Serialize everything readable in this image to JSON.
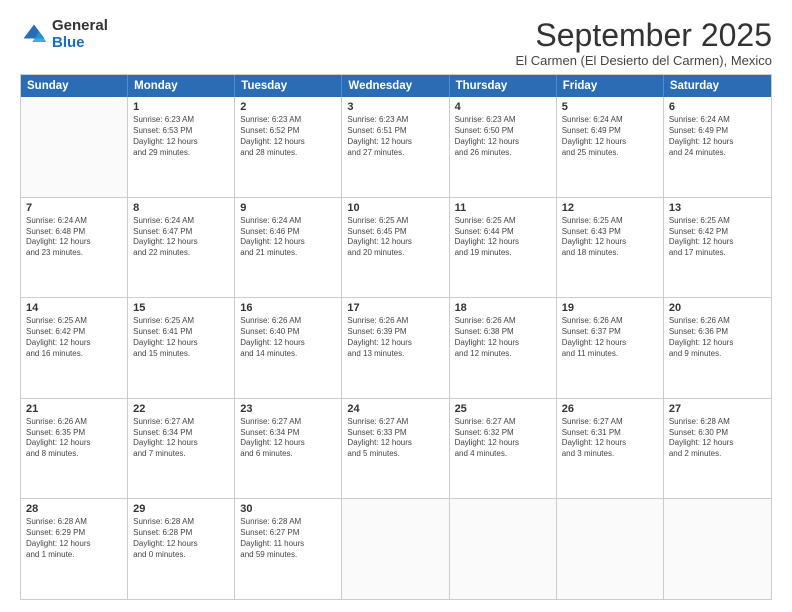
{
  "logo": {
    "general": "General",
    "blue": "Blue"
  },
  "title": "September 2025",
  "subtitle": "El Carmen (El Desierto del Carmen), Mexico",
  "header_days": [
    "Sunday",
    "Monday",
    "Tuesday",
    "Wednesday",
    "Thursday",
    "Friday",
    "Saturday"
  ],
  "rows": [
    [
      {
        "day": "",
        "lines": []
      },
      {
        "day": "1",
        "lines": [
          "Sunrise: 6:23 AM",
          "Sunset: 6:53 PM",
          "Daylight: 12 hours",
          "and 29 minutes."
        ]
      },
      {
        "day": "2",
        "lines": [
          "Sunrise: 6:23 AM",
          "Sunset: 6:52 PM",
          "Daylight: 12 hours",
          "and 28 minutes."
        ]
      },
      {
        "day": "3",
        "lines": [
          "Sunrise: 6:23 AM",
          "Sunset: 6:51 PM",
          "Daylight: 12 hours",
          "and 27 minutes."
        ]
      },
      {
        "day": "4",
        "lines": [
          "Sunrise: 6:23 AM",
          "Sunset: 6:50 PM",
          "Daylight: 12 hours",
          "and 26 minutes."
        ]
      },
      {
        "day": "5",
        "lines": [
          "Sunrise: 6:24 AM",
          "Sunset: 6:49 PM",
          "Daylight: 12 hours",
          "and 25 minutes."
        ]
      },
      {
        "day": "6",
        "lines": [
          "Sunrise: 6:24 AM",
          "Sunset: 6:49 PM",
          "Daylight: 12 hours",
          "and 24 minutes."
        ]
      }
    ],
    [
      {
        "day": "7",
        "lines": [
          "Sunrise: 6:24 AM",
          "Sunset: 6:48 PM",
          "Daylight: 12 hours",
          "and 23 minutes."
        ]
      },
      {
        "day": "8",
        "lines": [
          "Sunrise: 6:24 AM",
          "Sunset: 6:47 PM",
          "Daylight: 12 hours",
          "and 22 minutes."
        ]
      },
      {
        "day": "9",
        "lines": [
          "Sunrise: 6:24 AM",
          "Sunset: 6:46 PM",
          "Daylight: 12 hours",
          "and 21 minutes."
        ]
      },
      {
        "day": "10",
        "lines": [
          "Sunrise: 6:25 AM",
          "Sunset: 6:45 PM",
          "Daylight: 12 hours",
          "and 20 minutes."
        ]
      },
      {
        "day": "11",
        "lines": [
          "Sunrise: 6:25 AM",
          "Sunset: 6:44 PM",
          "Daylight: 12 hours",
          "and 19 minutes."
        ]
      },
      {
        "day": "12",
        "lines": [
          "Sunrise: 6:25 AM",
          "Sunset: 6:43 PM",
          "Daylight: 12 hours",
          "and 18 minutes."
        ]
      },
      {
        "day": "13",
        "lines": [
          "Sunrise: 6:25 AM",
          "Sunset: 6:42 PM",
          "Daylight: 12 hours",
          "and 17 minutes."
        ]
      }
    ],
    [
      {
        "day": "14",
        "lines": [
          "Sunrise: 6:25 AM",
          "Sunset: 6:42 PM",
          "Daylight: 12 hours",
          "and 16 minutes."
        ]
      },
      {
        "day": "15",
        "lines": [
          "Sunrise: 6:25 AM",
          "Sunset: 6:41 PM",
          "Daylight: 12 hours",
          "and 15 minutes."
        ]
      },
      {
        "day": "16",
        "lines": [
          "Sunrise: 6:26 AM",
          "Sunset: 6:40 PM",
          "Daylight: 12 hours",
          "and 14 minutes."
        ]
      },
      {
        "day": "17",
        "lines": [
          "Sunrise: 6:26 AM",
          "Sunset: 6:39 PM",
          "Daylight: 12 hours",
          "and 13 minutes."
        ]
      },
      {
        "day": "18",
        "lines": [
          "Sunrise: 6:26 AM",
          "Sunset: 6:38 PM",
          "Daylight: 12 hours",
          "and 12 minutes."
        ]
      },
      {
        "day": "19",
        "lines": [
          "Sunrise: 6:26 AM",
          "Sunset: 6:37 PM",
          "Daylight: 12 hours",
          "and 11 minutes."
        ]
      },
      {
        "day": "20",
        "lines": [
          "Sunrise: 6:26 AM",
          "Sunset: 6:36 PM",
          "Daylight: 12 hours",
          "and 9 minutes."
        ]
      }
    ],
    [
      {
        "day": "21",
        "lines": [
          "Sunrise: 6:26 AM",
          "Sunset: 6:35 PM",
          "Daylight: 12 hours",
          "and 8 minutes."
        ]
      },
      {
        "day": "22",
        "lines": [
          "Sunrise: 6:27 AM",
          "Sunset: 6:34 PM",
          "Daylight: 12 hours",
          "and 7 minutes."
        ]
      },
      {
        "day": "23",
        "lines": [
          "Sunrise: 6:27 AM",
          "Sunset: 6:34 PM",
          "Daylight: 12 hours",
          "and 6 minutes."
        ]
      },
      {
        "day": "24",
        "lines": [
          "Sunrise: 6:27 AM",
          "Sunset: 6:33 PM",
          "Daylight: 12 hours",
          "and 5 minutes."
        ]
      },
      {
        "day": "25",
        "lines": [
          "Sunrise: 6:27 AM",
          "Sunset: 6:32 PM",
          "Daylight: 12 hours",
          "and 4 minutes."
        ]
      },
      {
        "day": "26",
        "lines": [
          "Sunrise: 6:27 AM",
          "Sunset: 6:31 PM",
          "Daylight: 12 hours",
          "and 3 minutes."
        ]
      },
      {
        "day": "27",
        "lines": [
          "Sunrise: 6:28 AM",
          "Sunset: 6:30 PM",
          "Daylight: 12 hours",
          "and 2 minutes."
        ]
      }
    ],
    [
      {
        "day": "28",
        "lines": [
          "Sunrise: 6:28 AM",
          "Sunset: 6:29 PM",
          "Daylight: 12 hours",
          "and 1 minute."
        ]
      },
      {
        "day": "29",
        "lines": [
          "Sunrise: 6:28 AM",
          "Sunset: 6:28 PM",
          "Daylight: 12 hours",
          "and 0 minutes."
        ]
      },
      {
        "day": "30",
        "lines": [
          "Sunrise: 6:28 AM",
          "Sunset: 6:27 PM",
          "Daylight: 11 hours",
          "and 59 minutes."
        ]
      },
      {
        "day": "",
        "lines": []
      },
      {
        "day": "",
        "lines": []
      },
      {
        "day": "",
        "lines": []
      },
      {
        "day": "",
        "lines": []
      }
    ]
  ]
}
